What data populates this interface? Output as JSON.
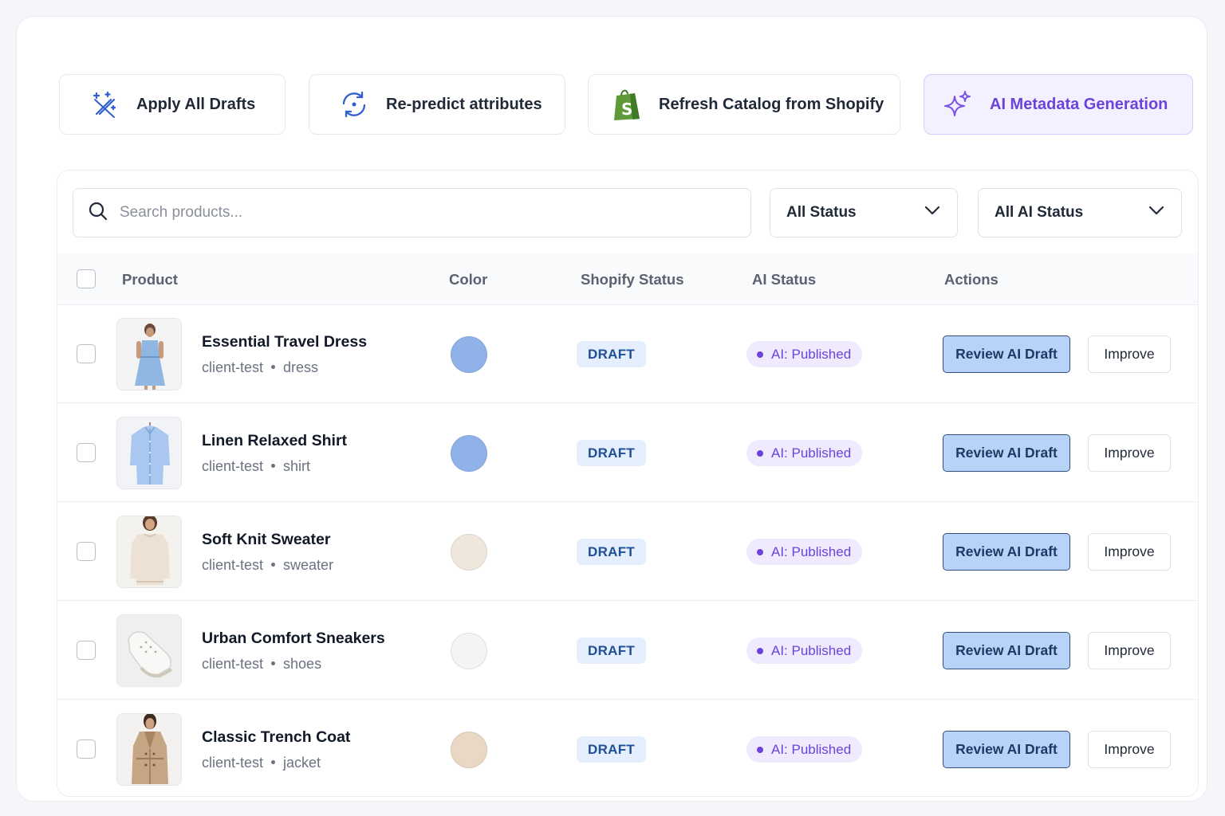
{
  "toolbar": {
    "apply_drafts": "Apply All Drafts",
    "repredict": "Re-predict attributes",
    "refresh_shopify": "Refresh Catalog from Shopify",
    "ai_metadata": "AI Metadata Generation"
  },
  "search": {
    "placeholder": "Search products..."
  },
  "filters": {
    "status": "All Status",
    "ai_status": "All AI Status"
  },
  "table": {
    "headers": {
      "product": "Product",
      "color": "Color",
      "shopify_status": "Shopify Status",
      "ai_status": "AI Status",
      "actions": "Actions"
    },
    "rows": [
      {
        "name": "Essential Travel Dress",
        "vendor": "client-test",
        "type": "dress",
        "color": "#8fb3e8",
        "shopify_status": "DRAFT",
        "ai_status": "AI: Published",
        "review_label": "Review AI Draft",
        "improve_label": "Improve"
      },
      {
        "name": "Linen Relaxed Shirt",
        "vendor": "client-test",
        "type": "shirt",
        "color": "#8fb3e8",
        "shopify_status": "DRAFT",
        "ai_status": "AI: Published",
        "review_label": "Review AI Draft",
        "improve_label": "Improve"
      },
      {
        "name": "Soft Knit Sweater",
        "vendor": "client-test",
        "type": "sweater",
        "color": "#efe6dc",
        "shopify_status": "DRAFT",
        "ai_status": "AI: Published",
        "review_label": "Review AI Draft",
        "improve_label": "Improve"
      },
      {
        "name": "Urban Comfort Sneakers",
        "vendor": "client-test",
        "type": "shoes",
        "color": "#f4f4f4",
        "shopify_status": "DRAFT",
        "ai_status": "AI: Published",
        "review_label": "Review AI Draft",
        "improve_label": "Improve"
      },
      {
        "name": "Classic Trench Coat",
        "vendor": "client-test",
        "type": "jacket",
        "color": "#e8d8c4",
        "shopify_status": "DRAFT",
        "ai_status": "AI: Published",
        "review_label": "Review AI Draft",
        "improve_label": "Improve"
      }
    ]
  }
}
